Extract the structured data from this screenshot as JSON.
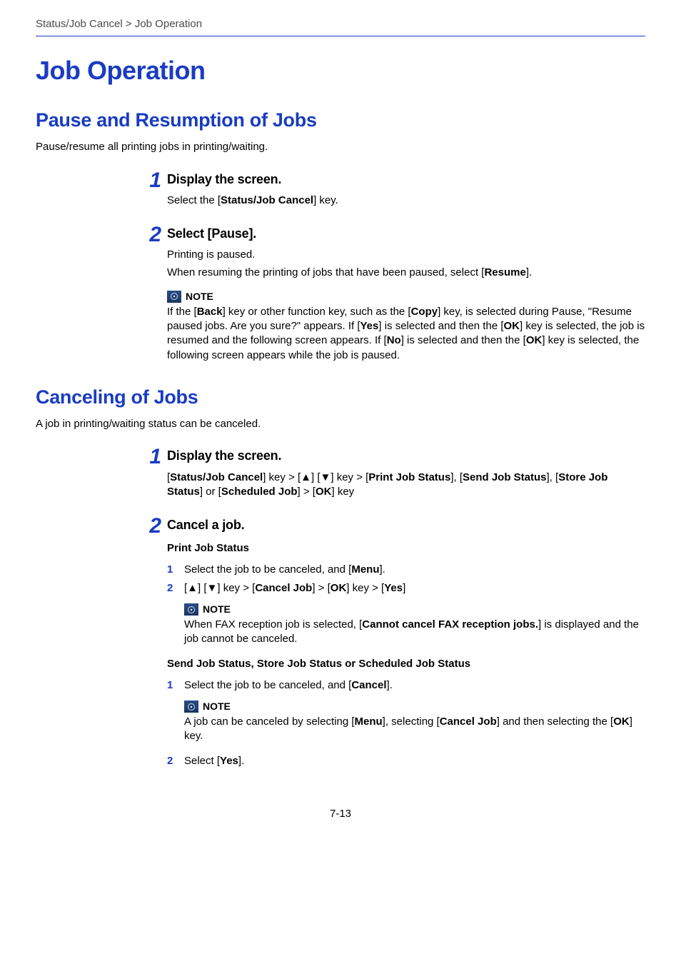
{
  "breadcrumb": "Status/Job Cancel > Job Operation",
  "h1": "Job Operation",
  "section1": {
    "title": "Pause and Resumption of Jobs",
    "intro": "Pause/resume all printing jobs in printing/waiting.",
    "steps": [
      {
        "num": "1",
        "title": "Display the screen.",
        "lines": [
          {
            "pre": "Select the [",
            "bold": "Status/Job Cancel",
            "post": "] key."
          }
        ]
      },
      {
        "num": "2",
        "title": "Select [Pause].",
        "lines": [
          {
            "plain": "Printing is paused."
          },
          {
            "pre": "When resuming the printing of jobs that have been paused, select [",
            "bold": "Resume",
            "post": "]."
          }
        ],
        "note": {
          "label": "NOTE",
          "text_parts": [
            "If the [",
            "Back",
            "] key or other function key, such as the [",
            "Copy",
            "] key, is selected during Pause, \"Resume paused jobs. Are you sure?\" appears. If [",
            "Yes",
            "] is selected and then the [",
            "OK",
            "] key is selected, the job is resumed and the following screen appears. If [",
            "No",
            "] is selected and then the [",
            "OK",
            "] key is selected, the following screen appears while the job is paused."
          ]
        }
      }
    ]
  },
  "section2": {
    "title": "Canceling of Jobs",
    "intro": "A job in printing/waiting status can be canceled.",
    "steps": [
      {
        "num": "1",
        "title": "Display the screen.",
        "nav_parts": [
          "[",
          "Status/Job Cancel",
          "] key > [▲] [▼] key > [",
          "Print Job Status",
          "], [",
          "Send Job Status",
          "], [",
          "Store Job Status",
          "] or [",
          "Scheduled Job",
          "] > [",
          "OK",
          "] key"
        ]
      },
      {
        "num": "2",
        "title": "Cancel a job.",
        "group1": {
          "heading": "Print Job Status",
          "substeps": [
            {
              "num": "1",
              "parts": [
                "Select the job to be canceled, and [",
                "Menu",
                "]."
              ]
            },
            {
              "num": "2",
              "parts": [
                "[▲] [▼] key > [",
                "Cancel Job",
                "] > [",
                "OK",
                "] key > [",
                "Yes",
                "]"
              ]
            }
          ],
          "note": {
            "label": "NOTE",
            "parts": [
              "When FAX reception job is selected, [",
              "Cannot cancel FAX reception jobs.",
              "] is displayed and the job cannot be canceled."
            ]
          }
        },
        "group2": {
          "heading": "Send Job Status, Store Job Status or Scheduled Job Status",
          "sub1": {
            "num": "1",
            "parts": [
              "Select the job to be canceled, and [",
              "Cancel",
              "]."
            ]
          },
          "note": {
            "label": "NOTE",
            "parts": [
              "A job can be canceled by selecting [",
              "Menu",
              "], selecting [",
              "Cancel Job",
              "] and then selecting the [",
              "OK",
              "] key."
            ]
          },
          "sub2": {
            "num": "2",
            "parts": [
              "Select [",
              "Yes",
              "]."
            ]
          }
        }
      }
    ]
  },
  "page_num": "7-13"
}
